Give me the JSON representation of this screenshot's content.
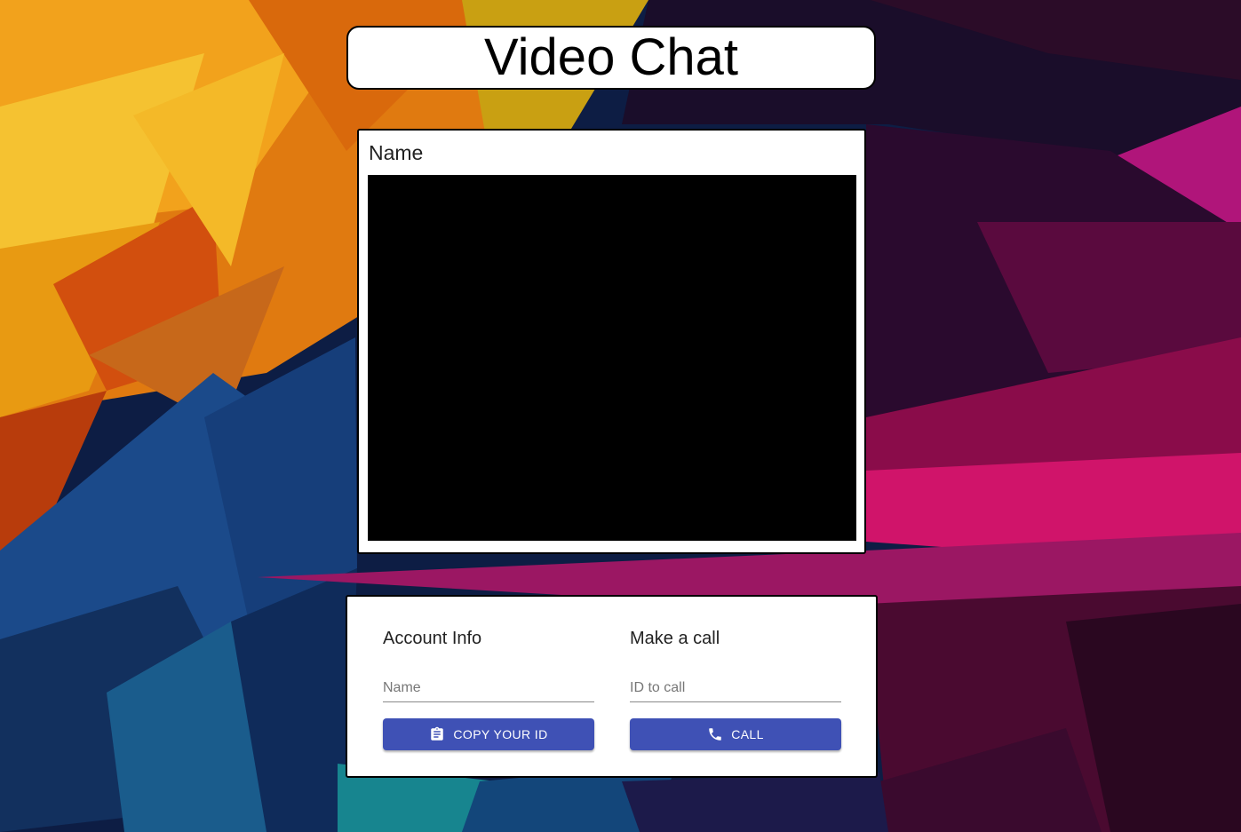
{
  "header": {
    "title": "Video Chat"
  },
  "video": {
    "label": "Name"
  },
  "options": {
    "account": {
      "heading": "Account Info",
      "name_placeholder": "Name",
      "name_value": "",
      "copy_button_label": "COPY YOUR ID",
      "copy_icon": "clipboard-icon"
    },
    "call": {
      "heading": "Make a call",
      "id_placeholder": "ID to call",
      "id_value": "",
      "call_button_label": "CALL",
      "call_icon": "phone-icon"
    }
  },
  "colors": {
    "button": "#3f51b5",
    "video_background": "#000000"
  }
}
